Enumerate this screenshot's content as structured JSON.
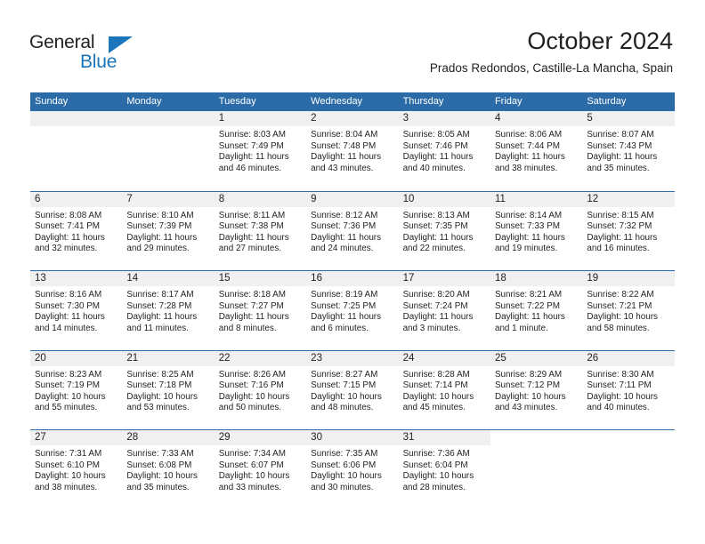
{
  "brand": {
    "name_part1": "General",
    "name_part2": "Blue",
    "accent_color": "#1b75bb"
  },
  "header": {
    "title": "October 2024",
    "location": "Prados Redondos, Castille-La Mancha, Spain"
  },
  "calendar": {
    "header_color": "#2b6ca8",
    "day_band_color": "#f0f0f0",
    "weekday_headers": [
      "Sunday",
      "Monday",
      "Tuesday",
      "Wednesday",
      "Thursday",
      "Friday",
      "Saturday"
    ],
    "weeks": [
      [
        {
          "day": "",
          "blank": true
        },
        {
          "day": "",
          "blank": true
        },
        {
          "day": "1",
          "sunrise": "Sunrise: 8:03 AM",
          "sunset": "Sunset: 7:49 PM",
          "daylight_line1": "Daylight: 11 hours",
          "daylight_line2": "and 46 minutes."
        },
        {
          "day": "2",
          "sunrise": "Sunrise: 8:04 AM",
          "sunset": "Sunset: 7:48 PM",
          "daylight_line1": "Daylight: 11 hours",
          "daylight_line2": "and 43 minutes."
        },
        {
          "day": "3",
          "sunrise": "Sunrise: 8:05 AM",
          "sunset": "Sunset: 7:46 PM",
          "daylight_line1": "Daylight: 11 hours",
          "daylight_line2": "and 40 minutes."
        },
        {
          "day": "4",
          "sunrise": "Sunrise: 8:06 AM",
          "sunset": "Sunset: 7:44 PM",
          "daylight_line1": "Daylight: 11 hours",
          "daylight_line2": "and 38 minutes."
        },
        {
          "day": "5",
          "sunrise": "Sunrise: 8:07 AM",
          "sunset": "Sunset: 7:43 PM",
          "daylight_line1": "Daylight: 11 hours",
          "daylight_line2": "and 35 minutes."
        }
      ],
      [
        {
          "day": "6",
          "sunrise": "Sunrise: 8:08 AM",
          "sunset": "Sunset: 7:41 PM",
          "daylight_line1": "Daylight: 11 hours",
          "daylight_line2": "and 32 minutes."
        },
        {
          "day": "7",
          "sunrise": "Sunrise: 8:10 AM",
          "sunset": "Sunset: 7:39 PM",
          "daylight_line1": "Daylight: 11 hours",
          "daylight_line2": "and 29 minutes."
        },
        {
          "day": "8",
          "sunrise": "Sunrise: 8:11 AM",
          "sunset": "Sunset: 7:38 PM",
          "daylight_line1": "Daylight: 11 hours",
          "daylight_line2": "and 27 minutes."
        },
        {
          "day": "9",
          "sunrise": "Sunrise: 8:12 AM",
          "sunset": "Sunset: 7:36 PM",
          "daylight_line1": "Daylight: 11 hours",
          "daylight_line2": "and 24 minutes."
        },
        {
          "day": "10",
          "sunrise": "Sunrise: 8:13 AM",
          "sunset": "Sunset: 7:35 PM",
          "daylight_line1": "Daylight: 11 hours",
          "daylight_line2": "and 22 minutes."
        },
        {
          "day": "11",
          "sunrise": "Sunrise: 8:14 AM",
          "sunset": "Sunset: 7:33 PM",
          "daylight_line1": "Daylight: 11 hours",
          "daylight_line2": "and 19 minutes."
        },
        {
          "day": "12",
          "sunrise": "Sunrise: 8:15 AM",
          "sunset": "Sunset: 7:32 PM",
          "daylight_line1": "Daylight: 11 hours",
          "daylight_line2": "and 16 minutes."
        }
      ],
      [
        {
          "day": "13",
          "sunrise": "Sunrise: 8:16 AM",
          "sunset": "Sunset: 7:30 PM",
          "daylight_line1": "Daylight: 11 hours",
          "daylight_line2": "and 14 minutes."
        },
        {
          "day": "14",
          "sunrise": "Sunrise: 8:17 AM",
          "sunset": "Sunset: 7:28 PM",
          "daylight_line1": "Daylight: 11 hours",
          "daylight_line2": "and 11 minutes."
        },
        {
          "day": "15",
          "sunrise": "Sunrise: 8:18 AM",
          "sunset": "Sunset: 7:27 PM",
          "daylight_line1": "Daylight: 11 hours",
          "daylight_line2": "and 8 minutes."
        },
        {
          "day": "16",
          "sunrise": "Sunrise: 8:19 AM",
          "sunset": "Sunset: 7:25 PM",
          "daylight_line1": "Daylight: 11 hours",
          "daylight_line2": "and 6 minutes."
        },
        {
          "day": "17",
          "sunrise": "Sunrise: 8:20 AM",
          "sunset": "Sunset: 7:24 PM",
          "daylight_line1": "Daylight: 11 hours",
          "daylight_line2": "and 3 minutes."
        },
        {
          "day": "18",
          "sunrise": "Sunrise: 8:21 AM",
          "sunset": "Sunset: 7:22 PM",
          "daylight_line1": "Daylight: 11 hours",
          "daylight_line2": "and 1 minute."
        },
        {
          "day": "19",
          "sunrise": "Sunrise: 8:22 AM",
          "sunset": "Sunset: 7:21 PM",
          "daylight_line1": "Daylight: 10 hours",
          "daylight_line2": "and 58 minutes."
        }
      ],
      [
        {
          "day": "20",
          "sunrise": "Sunrise: 8:23 AM",
          "sunset": "Sunset: 7:19 PM",
          "daylight_line1": "Daylight: 10 hours",
          "daylight_line2": "and 55 minutes."
        },
        {
          "day": "21",
          "sunrise": "Sunrise: 8:25 AM",
          "sunset": "Sunset: 7:18 PM",
          "daylight_line1": "Daylight: 10 hours",
          "daylight_line2": "and 53 minutes."
        },
        {
          "day": "22",
          "sunrise": "Sunrise: 8:26 AM",
          "sunset": "Sunset: 7:16 PM",
          "daylight_line1": "Daylight: 10 hours",
          "daylight_line2": "and 50 minutes."
        },
        {
          "day": "23",
          "sunrise": "Sunrise: 8:27 AM",
          "sunset": "Sunset: 7:15 PM",
          "daylight_line1": "Daylight: 10 hours",
          "daylight_line2": "and 48 minutes."
        },
        {
          "day": "24",
          "sunrise": "Sunrise: 8:28 AM",
          "sunset": "Sunset: 7:14 PM",
          "daylight_line1": "Daylight: 10 hours",
          "daylight_line2": "and 45 minutes."
        },
        {
          "day": "25",
          "sunrise": "Sunrise: 8:29 AM",
          "sunset": "Sunset: 7:12 PM",
          "daylight_line1": "Daylight: 10 hours",
          "daylight_line2": "and 43 minutes."
        },
        {
          "day": "26",
          "sunrise": "Sunrise: 8:30 AM",
          "sunset": "Sunset: 7:11 PM",
          "daylight_line1": "Daylight: 10 hours",
          "daylight_line2": "and 40 minutes."
        }
      ],
      [
        {
          "day": "27",
          "sunrise": "Sunrise: 7:31 AM",
          "sunset": "Sunset: 6:10 PM",
          "daylight_line1": "Daylight: 10 hours",
          "daylight_line2": "and 38 minutes."
        },
        {
          "day": "28",
          "sunrise": "Sunrise: 7:33 AM",
          "sunset": "Sunset: 6:08 PM",
          "daylight_line1": "Daylight: 10 hours",
          "daylight_line2": "and 35 minutes."
        },
        {
          "day": "29",
          "sunrise": "Sunrise: 7:34 AM",
          "sunset": "Sunset: 6:07 PM",
          "daylight_line1": "Daylight: 10 hours",
          "daylight_line2": "and 33 minutes."
        },
        {
          "day": "30",
          "sunrise": "Sunrise: 7:35 AM",
          "sunset": "Sunset: 6:06 PM",
          "daylight_line1": "Daylight: 10 hours",
          "daylight_line2": "and 30 minutes."
        },
        {
          "day": "31",
          "sunrise": "Sunrise: 7:36 AM",
          "sunset": "Sunset: 6:04 PM",
          "daylight_line1": "Daylight: 10 hours",
          "daylight_line2": "and 28 minutes."
        },
        {
          "day": "",
          "void": true
        },
        {
          "day": "",
          "void": true
        }
      ]
    ]
  }
}
